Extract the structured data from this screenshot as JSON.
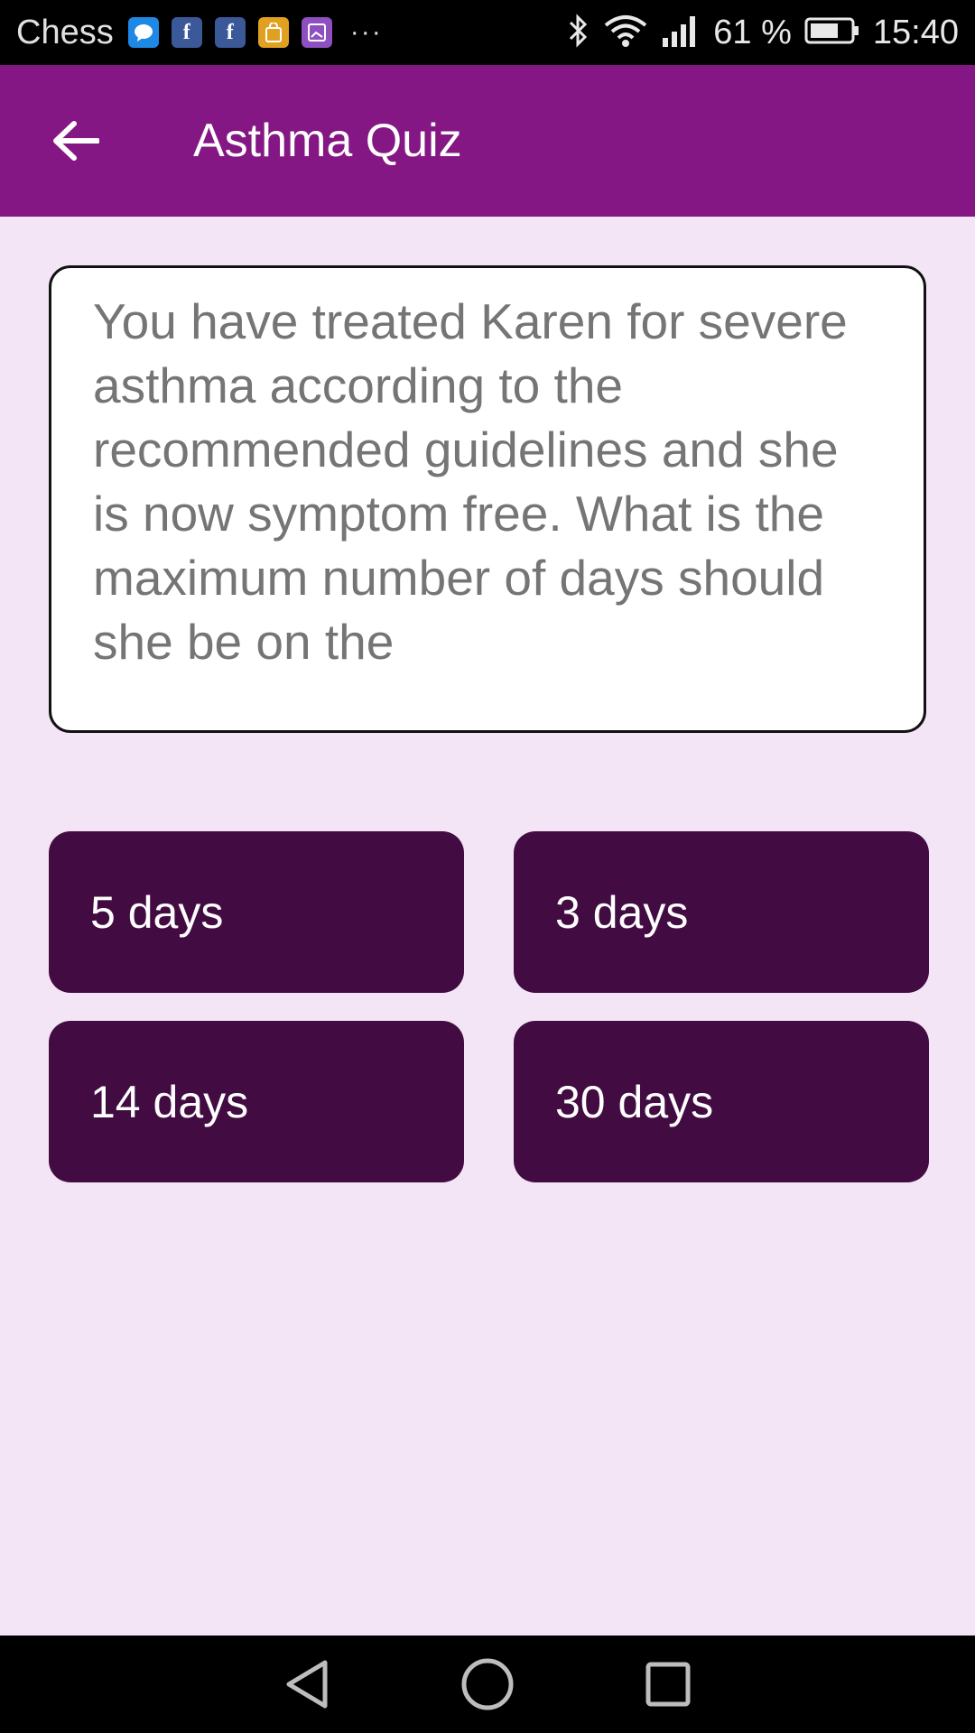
{
  "status_bar": {
    "app_name": "Chess",
    "notification_icons": [
      {
        "name": "messenger-icon",
        "color": "#1e88e5",
        "glyph": "💬"
      },
      {
        "name": "facebook-icon",
        "color": "#3b5998",
        "glyph": "f"
      },
      {
        "name": "facebook-icon",
        "color": "#3b5998",
        "glyph": "f"
      },
      {
        "name": "store-bag-icon",
        "color": "#e0a020",
        "glyph": "▪"
      },
      {
        "name": "gallery-icon",
        "color": "#8e4fc1",
        "glyph": "▫"
      }
    ],
    "overflow": "···",
    "battery_percent": "61 %",
    "time": "15:40"
  },
  "app_bar": {
    "title": "Asthma Quiz",
    "background": "#841784"
  },
  "question": {
    "text": "You have treated Karen for severe asthma according to the recommended guidelines and she is now symptom free. What is the maximum number of days  should she  be on the"
  },
  "answers": [
    {
      "label": "5 days"
    },
    {
      "label": "3 days"
    },
    {
      "label": "14 days"
    },
    {
      "label": "30 days"
    }
  ],
  "colors": {
    "content_bg": "#f3e5f5",
    "answer_bg": "#420c42"
  }
}
